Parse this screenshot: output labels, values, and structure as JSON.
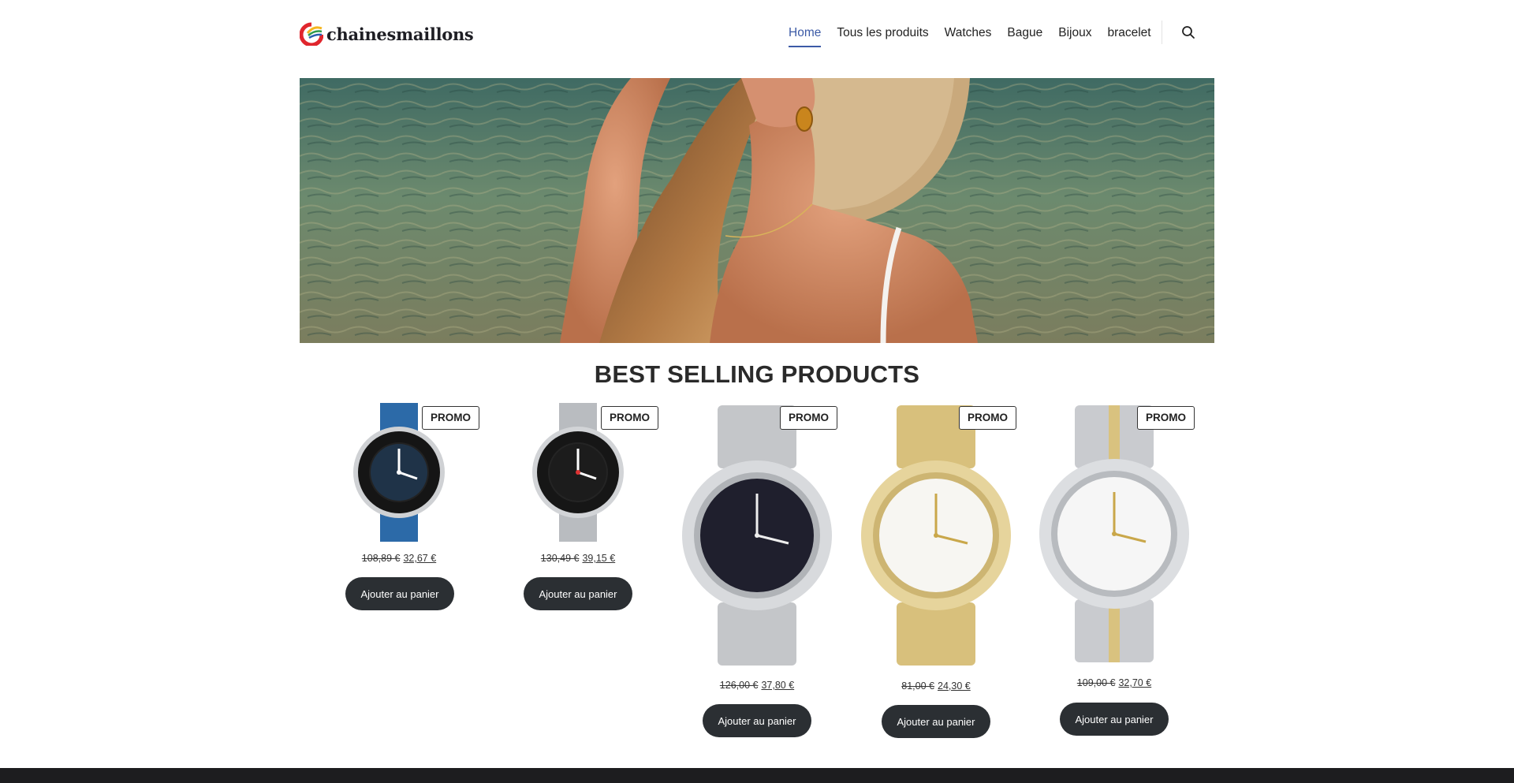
{
  "header": {
    "logo_text": "chainesmaillons",
    "nav": [
      {
        "label": "Home",
        "active": true
      },
      {
        "label": "Tous les produits",
        "active": false
      },
      {
        "label": "Watches",
        "active": false
      },
      {
        "label": "Bague",
        "active": false
      },
      {
        "label": "Bijoux",
        "active": false
      },
      {
        "label": "bracelet",
        "active": false
      }
    ],
    "search_icon": "search-icon",
    "accent_color": "#3c5aa6"
  },
  "hero": {
    "image": "woman-in-straw-hat-by-sea"
  },
  "section": {
    "title": "BEST SELLING PRODUCTS"
  },
  "products": [
    {
      "badge": "PROMO",
      "old_price": "108,89 €",
      "new_price": "32,67 €",
      "button": "Ajouter au panier",
      "image": "blue-strap-swiss-watch"
    },
    {
      "badge": "PROMO",
      "old_price": "130,49 €",
      "new_price": "39,15 €",
      "button": "Ajouter au panier",
      "image": "steel-swiss-watch"
    },
    {
      "badge": "PROMO",
      "old_price": "126,00 €",
      "new_price": "37,80 €",
      "button": "Ajouter au panier",
      "image": "seiko-black-dial"
    },
    {
      "badge": "PROMO",
      "old_price": "81,00 €",
      "new_price": "24,30 €",
      "button": "Ajouter au panier",
      "image": "seiko-gold"
    },
    {
      "badge": "PROMO",
      "old_price": "109,00 €",
      "new_price": "32,70 €",
      "button": "Ajouter au panier",
      "image": "seiko-two-tone"
    }
  ],
  "colors": {
    "button_bg": "#2b2f33",
    "footer": "#1d1d1f"
  }
}
